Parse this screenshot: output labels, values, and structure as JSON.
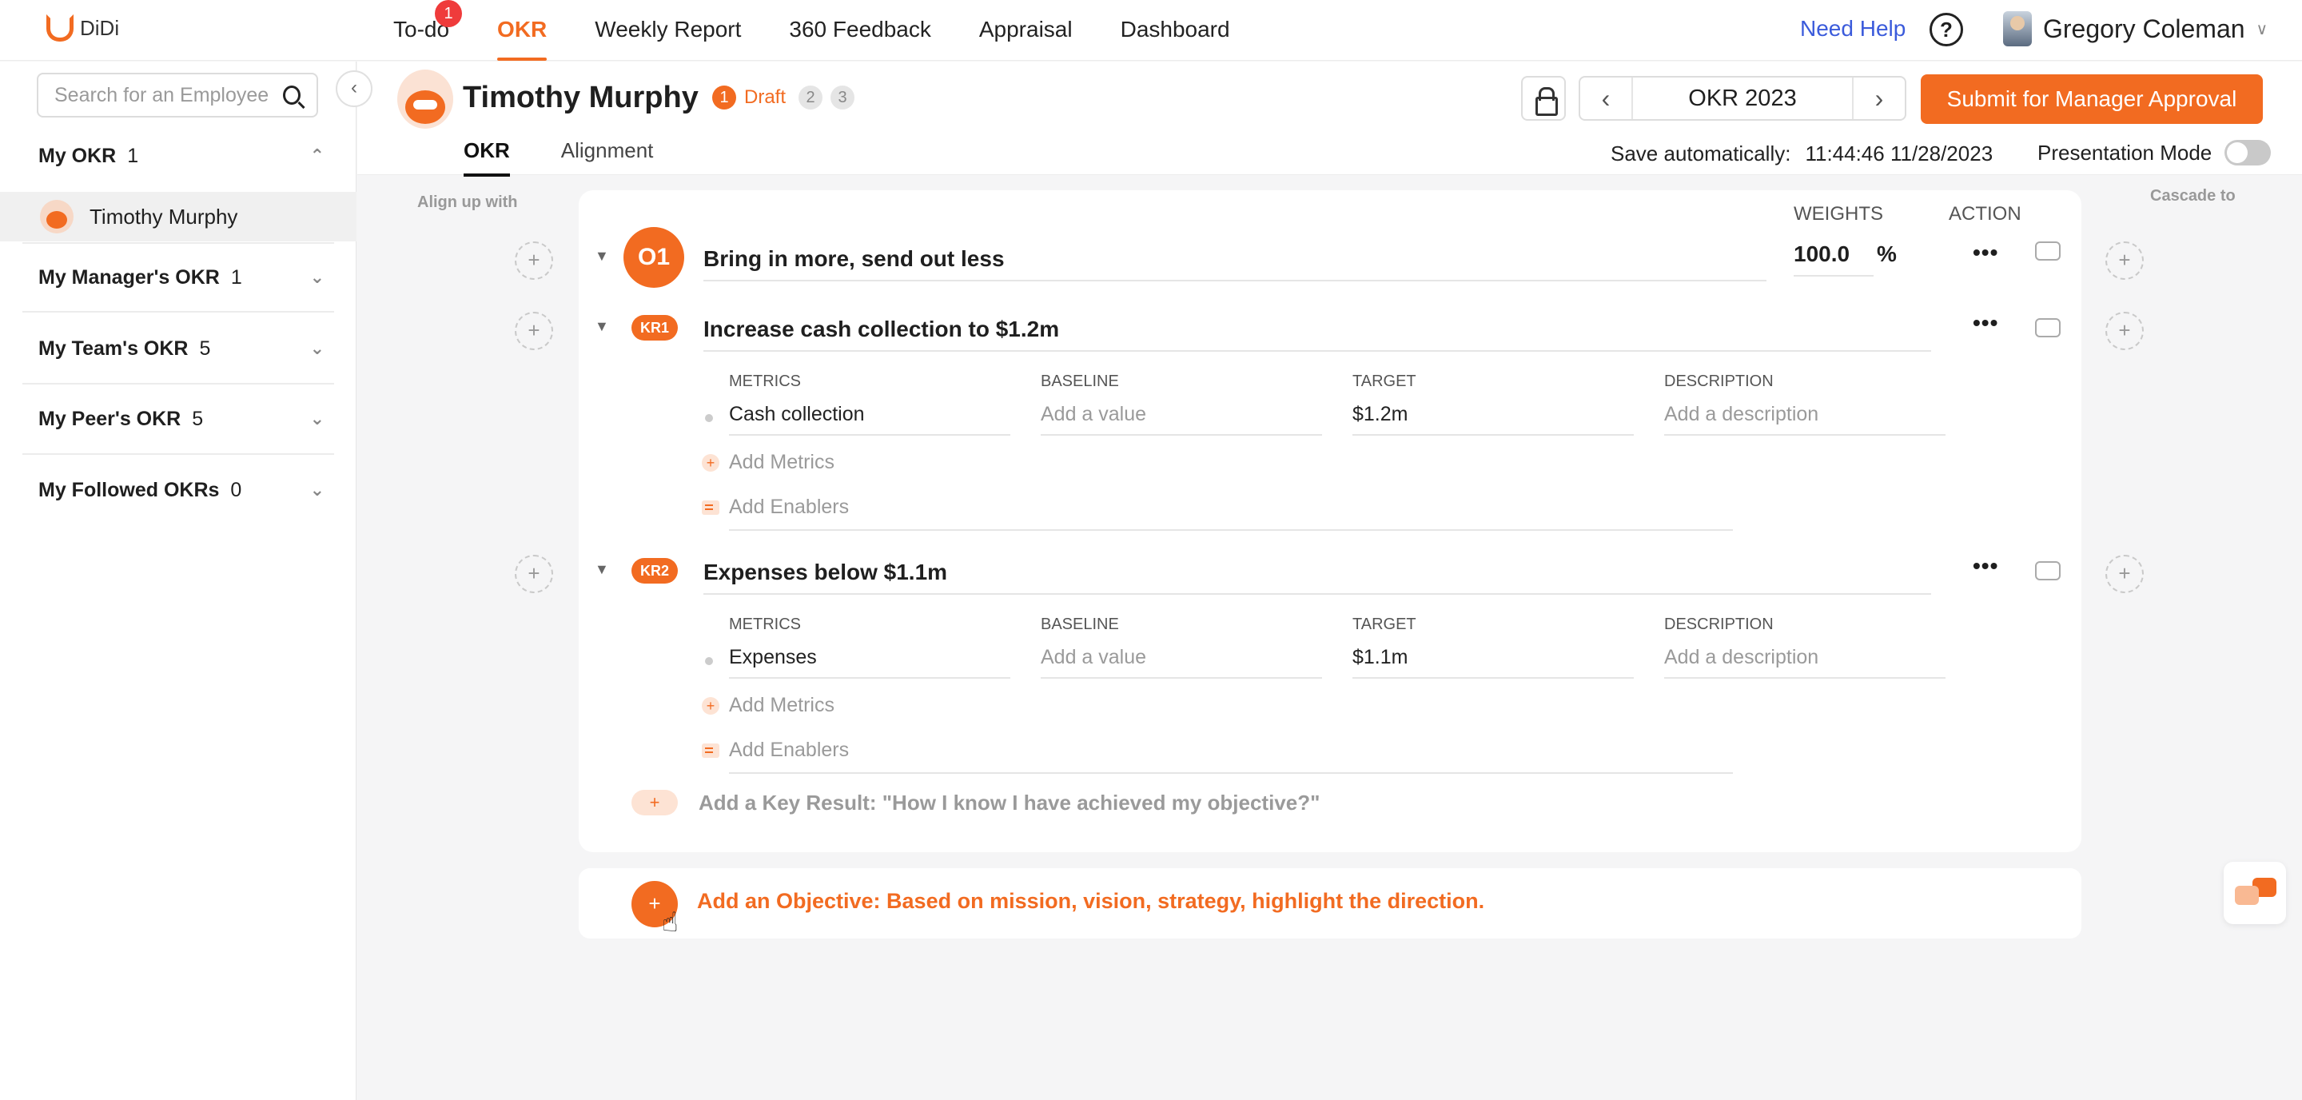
{
  "app": {
    "logo_text": "DiDi"
  },
  "nav": {
    "items": [
      {
        "label": "To-do",
        "badge": "1"
      },
      {
        "label": "OKR"
      },
      {
        "label": "Weekly Report"
      },
      {
        "label": "360 Feedback"
      },
      {
        "label": "Appraisal"
      },
      {
        "label": "Dashboard"
      }
    ],
    "active": "OKR",
    "need_help": "Need Help",
    "help_glyph": "?",
    "user_name": "Gregory Coleman"
  },
  "sidebar": {
    "search_placeholder": "Search for an Employee",
    "groups": [
      {
        "label": "My OKR",
        "count": "1",
        "expanded": true,
        "members": [
          "Timothy Murphy"
        ]
      },
      {
        "label": "My Manager's OKR",
        "count": "1"
      },
      {
        "label": "My Team's OKR",
        "count": "5"
      },
      {
        "label": "My Peer's OKR",
        "count": "5"
      },
      {
        "label": "My Followed OKRs",
        "count": "0"
      }
    ]
  },
  "header": {
    "employee_name": "Timothy Murphy",
    "steps": [
      "1",
      "2",
      "3"
    ],
    "step_label": "Draft",
    "period": "OKR 2023",
    "submit_label": "Submit for Manager Approval",
    "tabs": [
      "OKR",
      "Alignment"
    ],
    "autosave_label": "Save automatically:",
    "autosave_time": "11:44:46 11/28/2023",
    "presentation_label": "Presentation Mode",
    "presentation_on": false
  },
  "board": {
    "align_caption": "Align up with",
    "cascade_caption": "Cascade to",
    "weights_head": "WEIGHTS",
    "action_head": "ACTION",
    "objective": {
      "badge": "O1",
      "title": "Bring in more, send out less",
      "weight": "100.0",
      "weight_unit": "%"
    },
    "metric_headers": [
      "METRICS",
      "BASELINE",
      "TARGET",
      "DESCRIPTION"
    ],
    "key_results": [
      {
        "badge": "KR1",
        "title": "Increase cash collection to $1.2m",
        "metric": "Cash collection",
        "baseline_placeholder": "Add a value",
        "target": "$1.2m",
        "description_placeholder": "Add a description"
      },
      {
        "badge": "KR2",
        "title": "Expenses below $1.1m",
        "metric": "Expenses",
        "baseline_placeholder": "Add a value",
        "target": "$1.1m",
        "description_placeholder": "Add a description"
      }
    ],
    "add_metrics": "Add Metrics",
    "add_enablers": "Add Enablers",
    "add_kr": "Add a Key Result: \"How I know I have achieved my objective?\"",
    "add_objective": "Add an Objective: Based on mission, vision, strategy, highlight the direction."
  },
  "colors": {
    "accent": "#f26b21",
    "link": "#3b5bdb",
    "badge_red": "#ef3b3b"
  }
}
